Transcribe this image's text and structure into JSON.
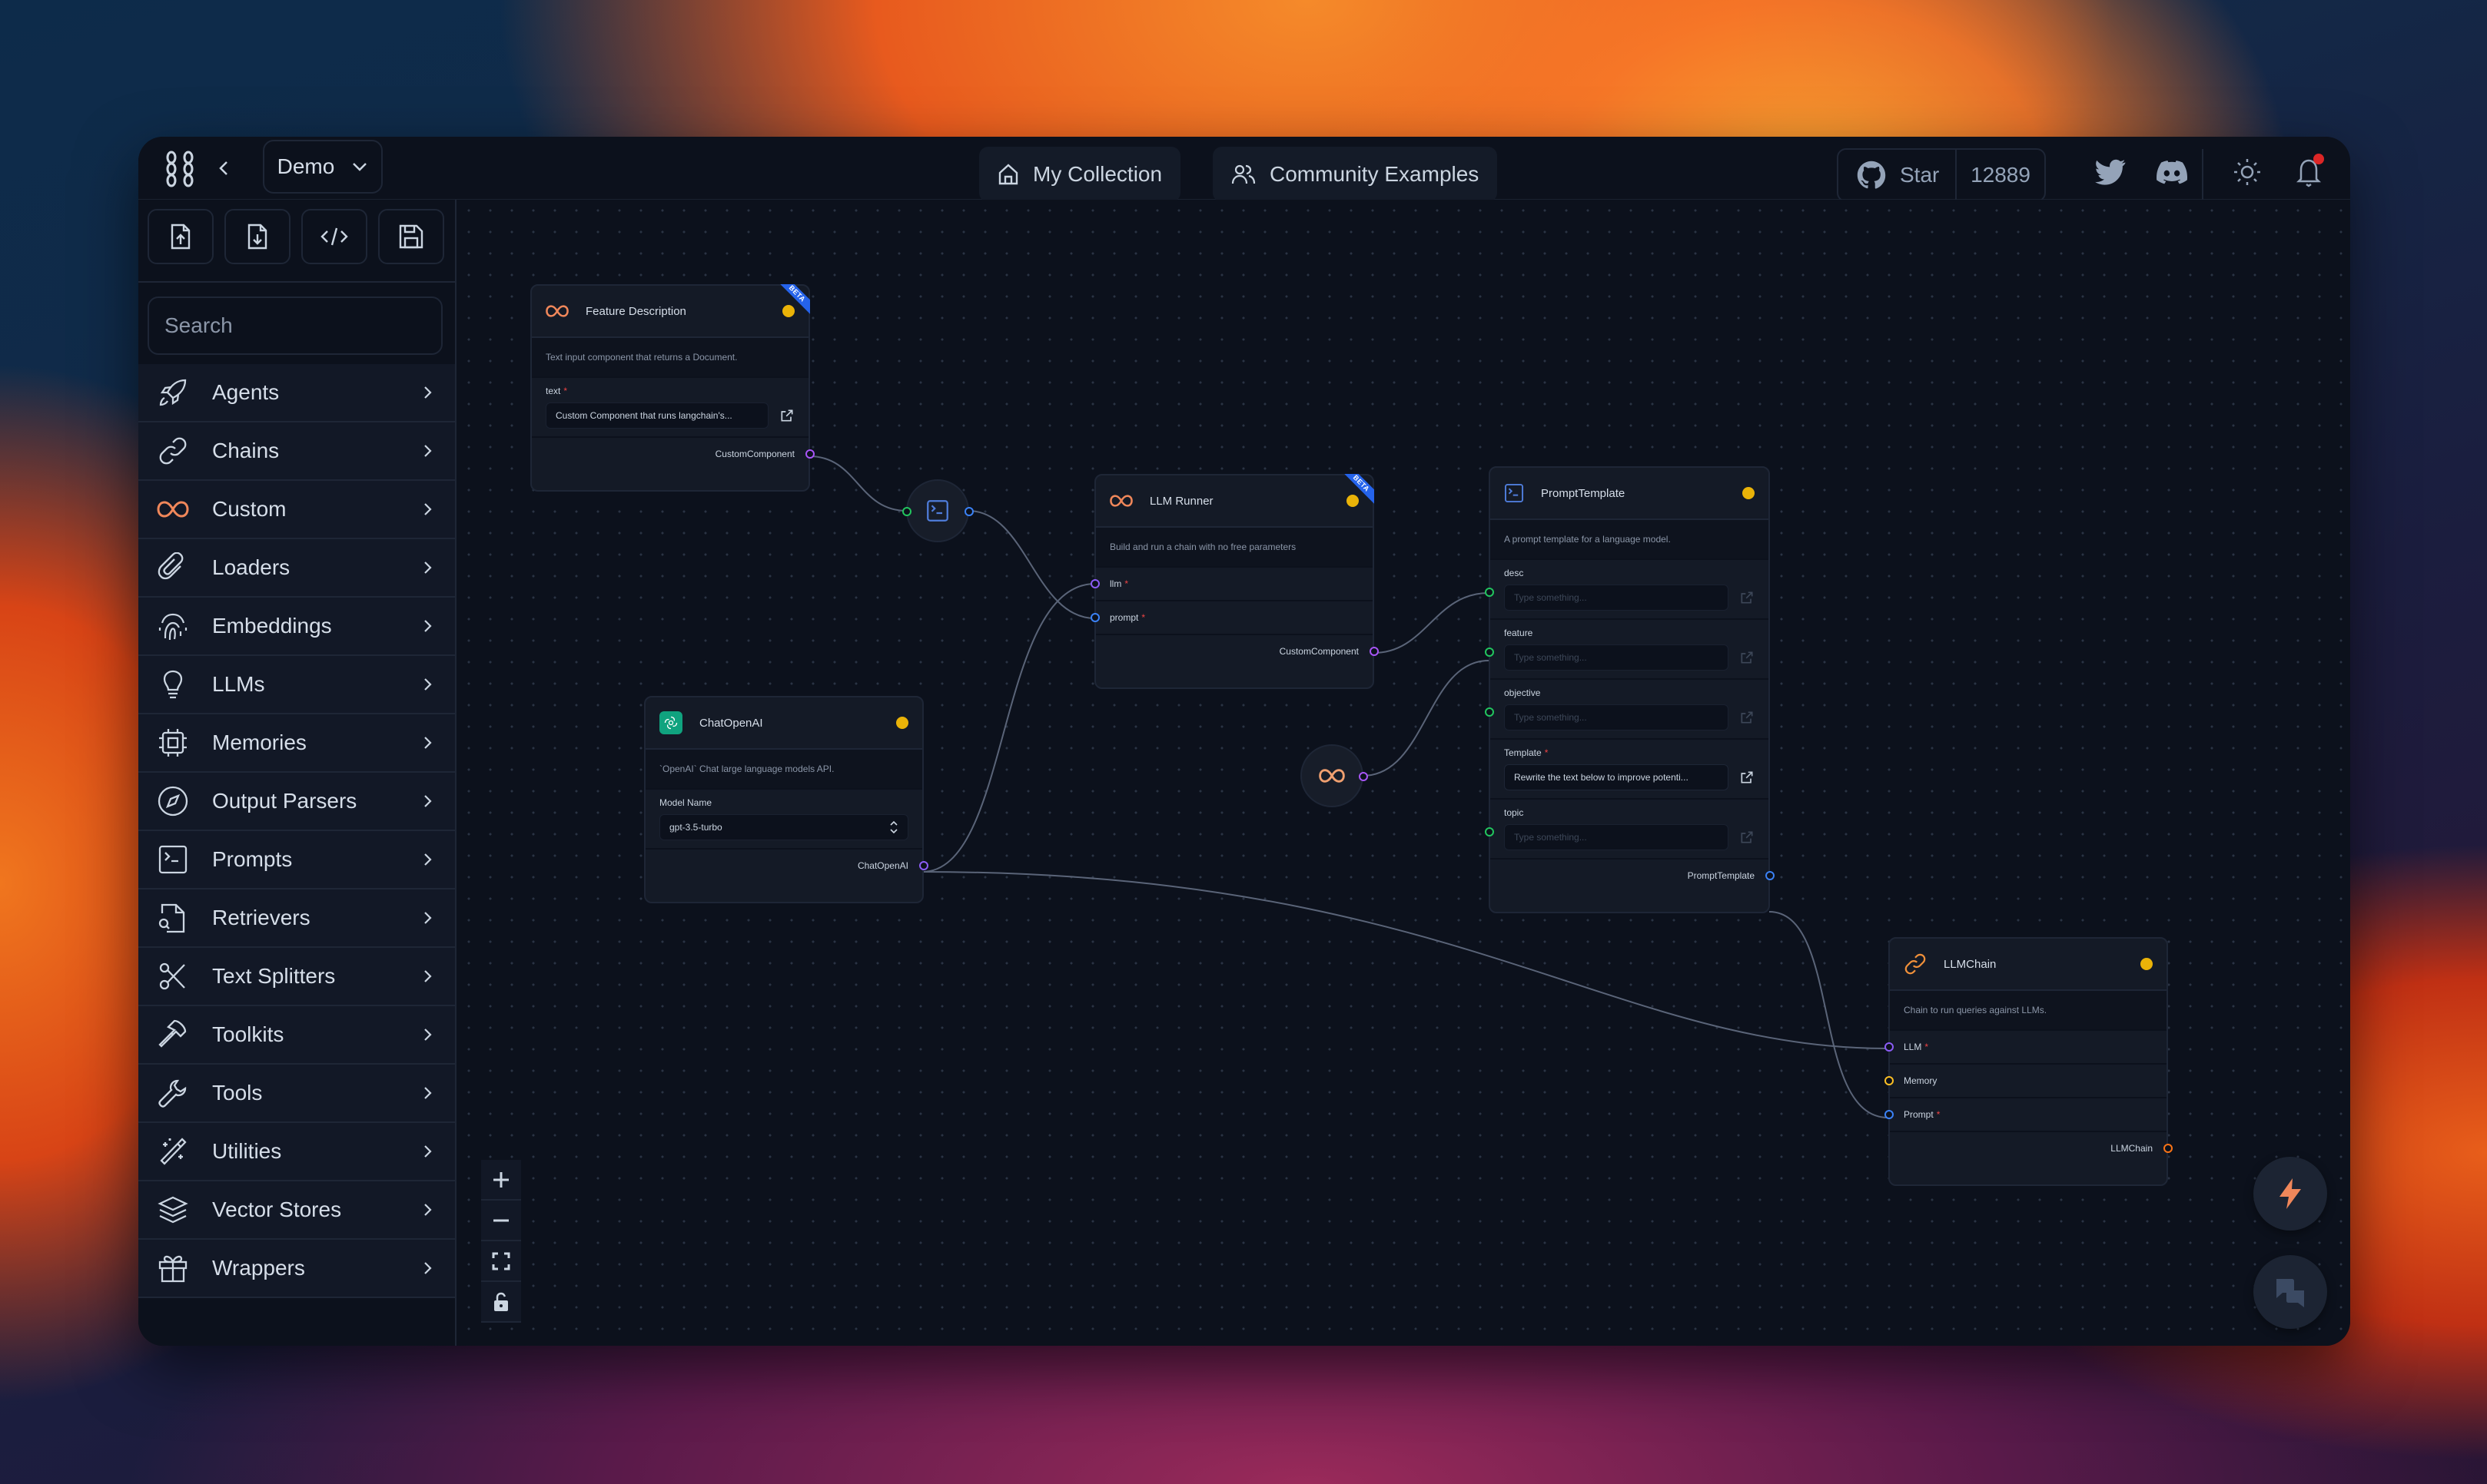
{
  "header": {
    "project_name": "Demo",
    "nav": [
      {
        "label": "My Collection",
        "icon": "home-icon"
      },
      {
        "label": "Community Examples",
        "icon": "users-icon"
      }
    ],
    "github": {
      "star_label": "Star",
      "star_count": "12889"
    },
    "notification_badge": true
  },
  "sidebar": {
    "search_placeholder": "Search",
    "toolbar": [
      "import",
      "export",
      "code",
      "save"
    ],
    "categories": [
      {
        "label": "Agents",
        "icon": "rocket-icon"
      },
      {
        "label": "Chains",
        "icon": "link-icon"
      },
      {
        "label": "Custom",
        "icon": "infinity-icon"
      },
      {
        "label": "Loaders",
        "icon": "paperclip-icon"
      },
      {
        "label": "Embeddings",
        "icon": "fingerprint-icon"
      },
      {
        "label": "LLMs",
        "icon": "lightbulb-icon"
      },
      {
        "label": "Memories",
        "icon": "cpu-icon"
      },
      {
        "label": "Output Parsers",
        "icon": "compass-icon"
      },
      {
        "label": "Prompts",
        "icon": "terminal-icon"
      },
      {
        "label": "Retrievers",
        "icon": "file-search-icon"
      },
      {
        "label": "Text Splitters",
        "icon": "scissors-icon"
      },
      {
        "label": "Toolkits",
        "icon": "hammer-icon"
      },
      {
        "label": "Tools",
        "icon": "wrench-icon"
      },
      {
        "label": "Utilities",
        "icon": "wand-icon"
      },
      {
        "label": "Vector Stores",
        "icon": "layers-icon"
      },
      {
        "label": "Wrappers",
        "icon": "gift-icon"
      }
    ]
  },
  "nodes": {
    "feature_description": {
      "title": "Feature Description",
      "badge": "BETA",
      "description": "Text input component that returns a Document.",
      "field_label": "text",
      "field_value": "Custom Component that runs langchain's...",
      "output": "CustomComponent"
    },
    "llm_runner": {
      "title": "LLM Runner",
      "badge": "BETA",
      "description": "Build and run a chain with no free parameters",
      "inputs": [
        "llm",
        "prompt"
      ],
      "output": "CustomComponent"
    },
    "prompt_template": {
      "title": "PromptTemplate",
      "description": "A prompt template for a language model.",
      "fields": [
        {
          "label": "desc",
          "placeholder": "Type something...",
          "value": ""
        },
        {
          "label": "feature",
          "placeholder": "Type something...",
          "value": ""
        },
        {
          "label": "objective",
          "placeholder": "Type something...",
          "value": ""
        },
        {
          "label": "Template",
          "required": true,
          "placeholder": "",
          "value": "Rewrite the text below to improve potenti..."
        },
        {
          "label": "topic",
          "placeholder": "Type something...",
          "value": ""
        }
      ],
      "output": "PromptTemplate"
    },
    "chat_openai": {
      "title": "ChatOpenAI",
      "description": "`OpenAI` Chat large language models API.",
      "field_label": "Model Name",
      "field_value": "gpt-3.5-turbo",
      "output": "ChatOpenAI"
    },
    "llm_chain": {
      "title": "LLMChain",
      "description": "Chain to run queries against LLMs.",
      "inputs": [
        "LLM",
        "Memory",
        "Prompt"
      ],
      "output": "LLMChain"
    }
  },
  "colors": {
    "accent_orange": "#f0875a",
    "status_yellow": "#eab308",
    "beta_blue": "#2563eb",
    "port_purple": "#a855f7",
    "port_violet": "#8b5cf6",
    "port_blue": "#3b82f6",
    "port_green": "#22c55e",
    "port_amber": "#fbbf24",
    "port_orange": "#f97316",
    "openai_green": "#10a37f"
  }
}
